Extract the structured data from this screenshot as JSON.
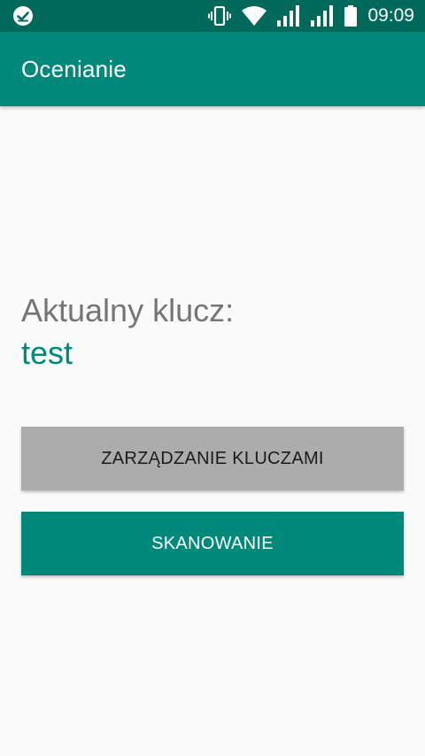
{
  "status_bar": {
    "time": "09:09",
    "icons": [
      "check-badge-icon",
      "vibrate-icon",
      "wifi-icon",
      "signal-icon",
      "signal-icon",
      "battery-icon"
    ]
  },
  "app_bar": {
    "title": "Ocenianie"
  },
  "main": {
    "key_label": "Aktualny klucz:",
    "key_value": "test",
    "manage_keys_button": "ZARZĄDZANIE KLUCZAMI",
    "scan_button": "SKANOWANIE"
  },
  "colors": {
    "primary": "#00897b",
    "primary_dark": "#00695c",
    "secondary_button": "#acacac",
    "background": "#fafafa"
  }
}
